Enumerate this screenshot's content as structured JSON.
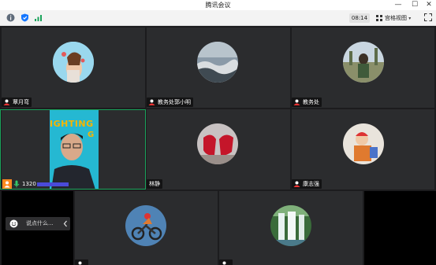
{
  "window": {
    "title": "腾讯会议",
    "minimize": "—",
    "maximize": "☐",
    "close": "✕"
  },
  "toolbar": {
    "info_icon": "info-icon",
    "shield_icon": "shield-icon",
    "signal_icon": "signal-bars-icon",
    "timer": "08:14",
    "view_label": "宫格视图",
    "view_icon": "grid-view-icon",
    "fullscreen_icon": "fullscreen-icon"
  },
  "participants": [
    {
      "name": "覃月弯",
      "host_icon": "host-badge-icon"
    },
    {
      "name": "教务处郭小明",
      "host_icon": "host-badge-icon"
    },
    {
      "name": "教务处",
      "host_icon": "host-badge-icon"
    },
    {
      "name": "1320",
      "mic_icon": "mic-on-icon",
      "mic_color": "#35c76b",
      "person_icon": "person-icon",
      "person_color": "#ff8a1f"
    },
    {
      "name": "林静"
    },
    {
      "name": "康志强",
      "host_icon": "host-badge-icon"
    },
    {
      "name": "",
      "host_icon": "host-badge-icon"
    },
    {
      "name": "",
      "host_icon": "host-badge-icon"
    }
  ],
  "speaker_video": {
    "banner_text": "IGHTING",
    "banner_right": "G",
    "banner_color": "#f7b500",
    "bg_color": "#25b8d2"
  },
  "chat": {
    "placeholder": "说点什么...",
    "icon": "emoji-icon",
    "collapse_icon": "chevron-left-icon"
  },
  "colors": {
    "active_speaker_border": "#1aa35b",
    "tile_bg": "#2b2c2e"
  }
}
